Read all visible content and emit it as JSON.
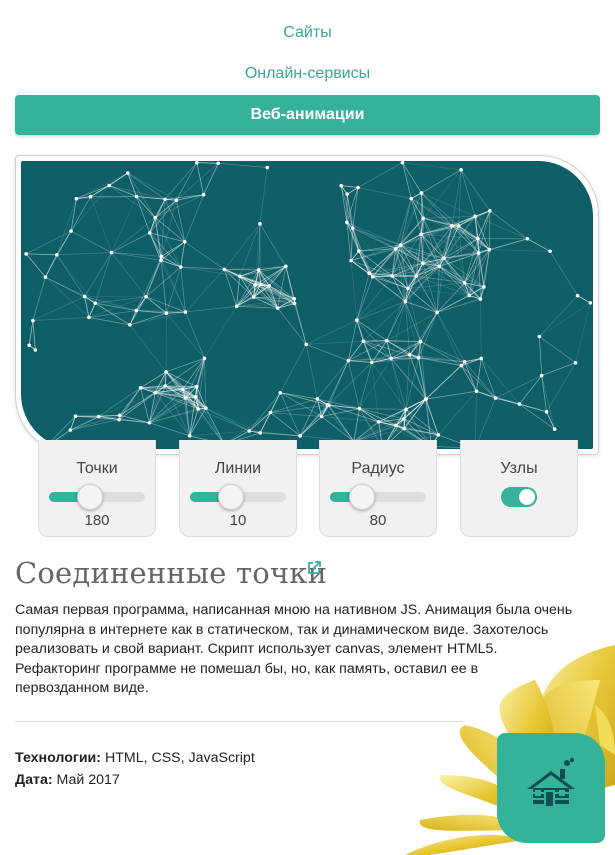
{
  "nav": {
    "items": [
      "Сайты",
      "Онлайн-сервисы"
    ],
    "active": "Веб-анимации"
  },
  "controls": {
    "points": {
      "label": "Точки",
      "value": "180",
      "level": 0.42
    },
    "lines": {
      "label": "Линии",
      "value": "10",
      "level": 0.42
    },
    "radius": {
      "label": "Радиус",
      "value": "80",
      "level": 0.32
    },
    "nodes": {
      "label": "Узлы",
      "on": true
    }
  },
  "project": {
    "title": "Соединенные точки",
    "description": "Самая первая программа, написанная мною на нативном JS. Анимация была очень популярна в интернете как в статическом, так и динамическом виде. Захотелось реализовать и свой вариант. Скрипт использует canvas, элемент HTML5. Рефакторинг программе не помешал бы, но, как память, оставил ее в первозданном виде.",
    "tech_label": "Технологии:",
    "tech_value": "HTML, CSS, JavaScript",
    "date_label": "Дата:",
    "date_value": "Май 2017"
  },
  "colors": {
    "accent": "#35b39a",
    "canvas_bg": "#0d5e66",
    "deco_gold": "#e8c838"
  },
  "icons": [
    "external-link-icon",
    "home-icon"
  ]
}
